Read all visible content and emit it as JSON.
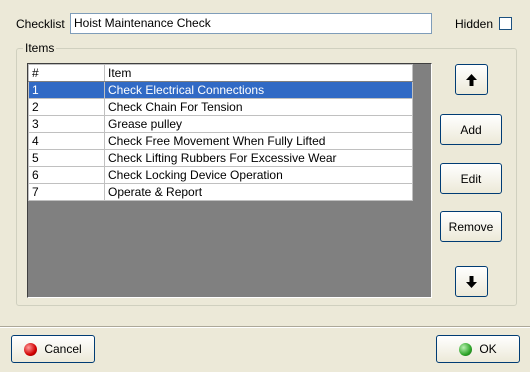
{
  "header": {
    "checklist_label": "Checklist",
    "checklist_value": "Hoist Maintenance Check",
    "hidden_label": "Hidden",
    "hidden_checked": false
  },
  "items_group": {
    "label": "Items",
    "columns": [
      "#",
      "Item"
    ],
    "rows": [
      {
        "num": "1",
        "item": "Check Electrical Connections",
        "selected": true
      },
      {
        "num": "2",
        "item": "Check Chain For Tension",
        "selected": false
      },
      {
        "num": "3",
        "item": "Grease pulley",
        "selected": false
      },
      {
        "num": "4",
        "item": "Check Free Movement When Fully Lifted",
        "selected": false
      },
      {
        "num": "5",
        "item": "Check Lifting Rubbers For Excessive Wear",
        "selected": false
      },
      {
        "num": "6",
        "item": "Check Locking Device Operation",
        "selected": false
      },
      {
        "num": "7",
        "item": "Operate & Report",
        "selected": false
      }
    ]
  },
  "side_buttons": {
    "move_up_icon": "arrow-up-icon",
    "add": "Add",
    "edit": "Edit",
    "remove": "Remove",
    "move_down_icon": "arrow-down-icon"
  },
  "footer": {
    "cancel": "Cancel",
    "ok": "OK",
    "cancel_icon_color": "#d10000",
    "ok_icon_color": "#2fa52a"
  }
}
